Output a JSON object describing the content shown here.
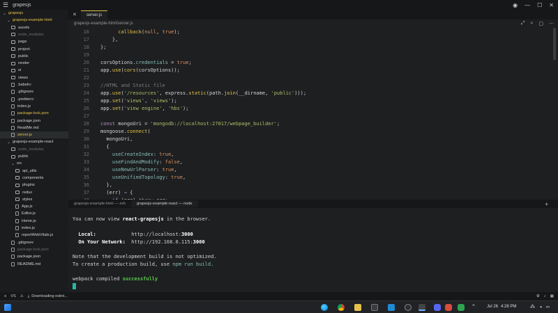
{
  "titlebar": {
    "app_name": "grapesjs"
  },
  "sidebar": {
    "items": [
      {
        "label": "grapesjs",
        "color": "yellow",
        "kind": "root",
        "indent": 0
      },
      {
        "label": "grapesjs-example-html",
        "color": "yellow",
        "kind": "folder-open",
        "indent": 1
      },
      {
        "label": "assets",
        "color": "white",
        "kind": "folder",
        "indent": 2
      },
      {
        "label": "node_modules",
        "color": "grey",
        "kind": "folder",
        "indent": 2
      },
      {
        "label": "page",
        "color": "white",
        "kind": "folder",
        "indent": 2
      },
      {
        "label": "project",
        "color": "white",
        "kind": "folder",
        "indent": 2
      },
      {
        "label": "public",
        "color": "white",
        "kind": "folder",
        "indent": 2
      },
      {
        "label": "render",
        "color": "white",
        "kind": "folder",
        "indent": 2
      },
      {
        "label": "ui",
        "color": "white",
        "kind": "folder",
        "indent": 2
      },
      {
        "label": "views",
        "color": "white",
        "kind": "folder",
        "indent": 2
      },
      {
        "label": ".babelrc",
        "color": "white",
        "kind": "file",
        "indent": 2
      },
      {
        "label": ".gitignore",
        "color": "white",
        "kind": "file",
        "indent": 2
      },
      {
        "label": ".prettierrc",
        "color": "white",
        "kind": "file",
        "indent": 2
      },
      {
        "label": "index.js",
        "color": "white",
        "kind": "file",
        "indent": 2
      },
      {
        "label": "package-lock.json",
        "color": "yellow",
        "kind": "file",
        "indent": 2
      },
      {
        "label": "package.json",
        "color": "white",
        "kind": "file",
        "indent": 2
      },
      {
        "label": "ReadMe.md",
        "color": "white",
        "kind": "file",
        "indent": 2
      },
      {
        "label": "server.js",
        "color": "yellow",
        "kind": "file",
        "indent": 2,
        "selected": true
      },
      {
        "label": "grapesjs-example-react",
        "color": "white",
        "kind": "folder-open",
        "indent": 1
      },
      {
        "label": "node_modules",
        "color": "grey",
        "kind": "folder",
        "indent": 2
      },
      {
        "label": "public",
        "color": "white",
        "kind": "folder",
        "indent": 2
      },
      {
        "label": "src",
        "color": "white",
        "kind": "folder-open",
        "indent": 2
      },
      {
        "label": "api_utils",
        "color": "white",
        "kind": "folder",
        "indent": 3
      },
      {
        "label": "components",
        "color": "white",
        "kind": "folder",
        "indent": 3
      },
      {
        "label": "plugins",
        "color": "white",
        "kind": "folder",
        "indent": 3
      },
      {
        "label": "redux",
        "color": "white",
        "kind": "folder",
        "indent": 3
      },
      {
        "label": "styles",
        "color": "white",
        "kind": "folder",
        "indent": 3
      },
      {
        "label": "App.js",
        "color": "white",
        "kind": "file",
        "indent": 3
      },
      {
        "label": "Editor.js",
        "color": "white",
        "kind": "file",
        "indent": 3
      },
      {
        "label": "Home.js",
        "color": "white",
        "kind": "file",
        "indent": 3
      },
      {
        "label": "index.js",
        "color": "white",
        "kind": "file",
        "indent": 3
      },
      {
        "label": "reportWebVitals.js",
        "color": "white",
        "kind": "file",
        "indent": 3
      },
      {
        "label": ".gitignore",
        "color": "white",
        "kind": "file",
        "indent": 2
      },
      {
        "label": "package-lock.json",
        "color": "grey",
        "kind": "file",
        "indent": 2
      },
      {
        "label": "package.json",
        "color": "white",
        "kind": "file",
        "indent": 2
      },
      {
        "label": "README.md",
        "color": "white",
        "kind": "file",
        "indent": 2
      }
    ]
  },
  "editor": {
    "tab_label": "server.js",
    "breadcrumb": "grapesjs-example-html/server.js",
    "line_numbers": [
      "16",
      "17",
      "18",
      "19",
      "20",
      "21",
      "22",
      "23",
      "24",
      "25",
      "26",
      "27",
      "28",
      "29",
      "30",
      "31",
      "32",
      "33",
      "34",
      "35",
      "36",
      "37",
      "38"
    ]
  },
  "terminal": {
    "tabs": [
      "grapesjs-example-html — zsh",
      "grapesjs-example-react — node"
    ],
    "lines": {
      "l1a": "You can now view ",
      "l1b": "react-grapesjs",
      "l1c": " in the browser.",
      "local_label": "  Local:",
      "local_url_a": "            http://localhost:",
      "local_port": "3000",
      "net_label": "  On Your Network:",
      "net_url_a": "  http://192.168.0.115:",
      "net_port": "3000",
      "note1": "Note that the development build is not optimized.",
      "note2a": "To create a production build, use ",
      "note2b": "npm run build",
      "note2c": ".",
      "wp_a": "webpack compiled ",
      "wp_b": "successfully"
    }
  },
  "statusbar": {
    "left_text": "VS",
    "download": "Downloading eslint..."
  },
  "taskbar": {
    "time": "4:28 PM",
    "date": "Jul 26"
  }
}
